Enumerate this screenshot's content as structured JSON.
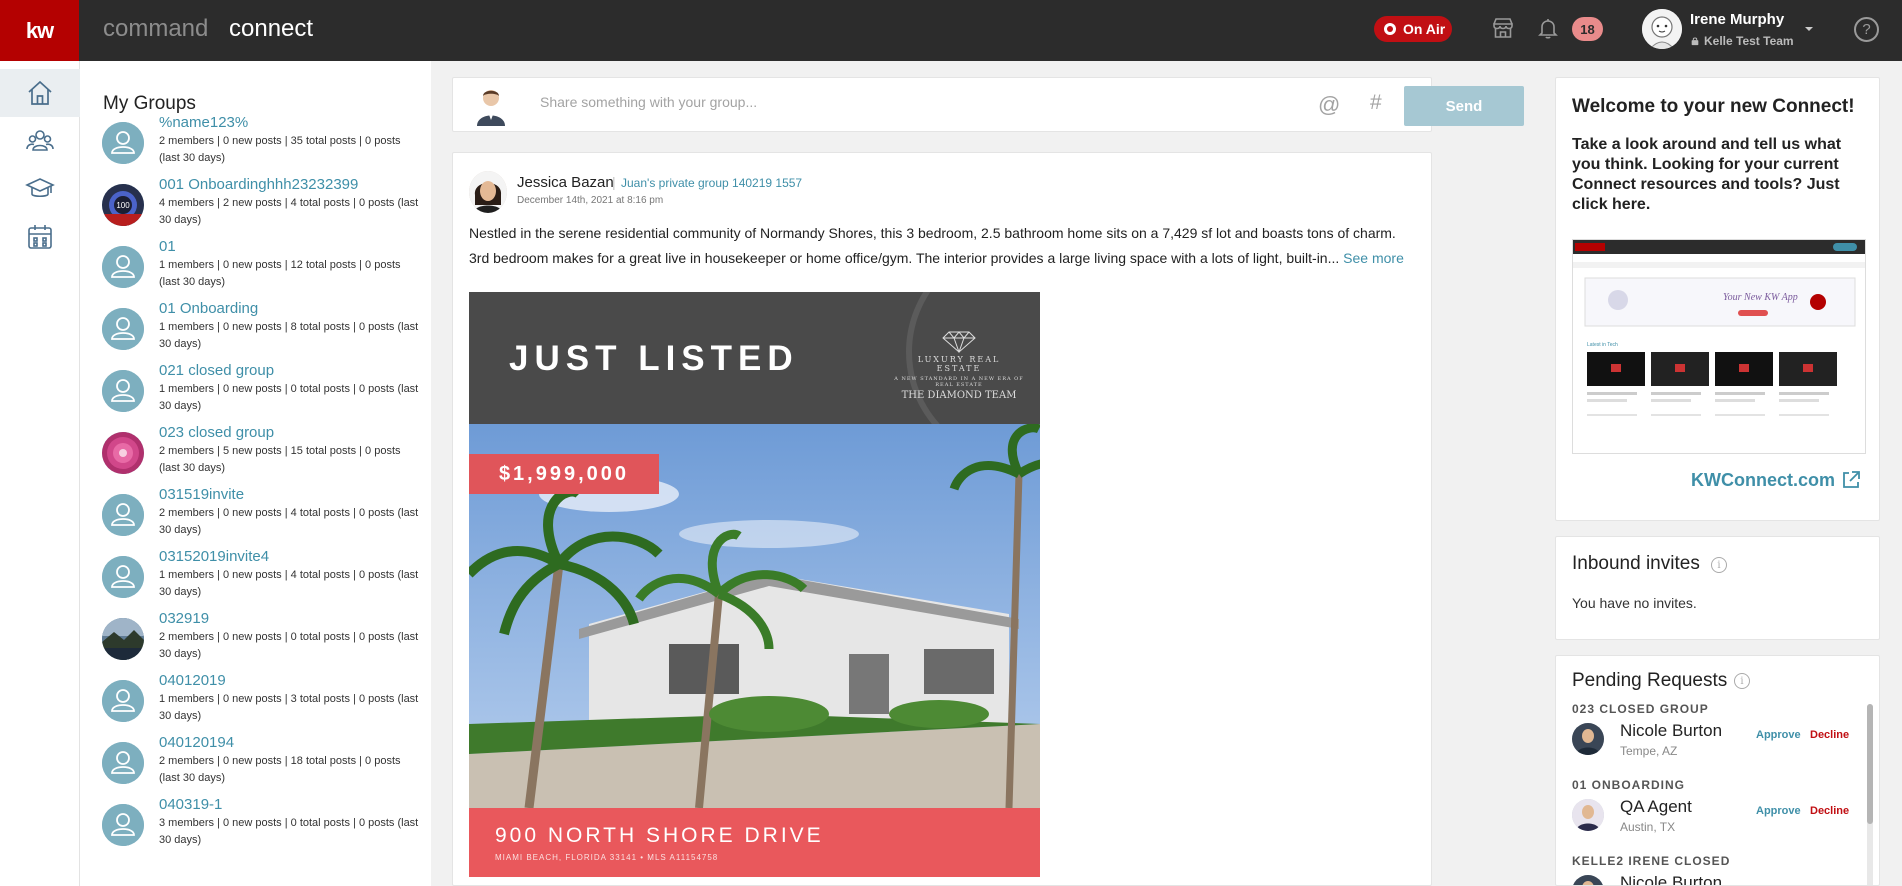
{
  "header": {
    "logo": "kw",
    "brand_command": "command",
    "brand_connect": "connect",
    "on_air_label": "On Air",
    "notification_count": "18",
    "user_name": "Irene Murphy",
    "user_team": "Kelle Test Team",
    "help_label": "?"
  },
  "rail": {
    "items": [
      {
        "icon": "home-icon",
        "active": true
      },
      {
        "icon": "groups-icon",
        "active": false
      },
      {
        "icon": "graduation-cap-icon",
        "active": false
      },
      {
        "icon": "calendar-icon",
        "active": false
      }
    ]
  },
  "groups": {
    "title": "My Groups",
    "items": [
      {
        "name": "%name123%",
        "meta": "2 members | 0 new posts | 35 total posts | 0 posts (last 30 days)",
        "avatar": "default"
      },
      {
        "name": "001 Onboardinghhh23232399",
        "meta": "4 members | 2 new posts | 4 total posts | 0 posts (last 30 days)",
        "avatar": "badge-100"
      },
      {
        "name": "01",
        "meta": "1 members | 0 new posts | 12 total posts | 0 posts (last 30 days)",
        "avatar": "default"
      },
      {
        "name": "01 Onboarding",
        "meta": "1 members | 0 new posts | 8 total posts | 0 posts (last 30 days)",
        "avatar": "default"
      },
      {
        "name": "021 closed group",
        "meta": "1 members | 0 new posts | 0 total posts | 0 posts (last 30 days)",
        "avatar": "default"
      },
      {
        "name": "023 closed group",
        "meta": "2 members | 5 new posts | 15 total posts | 0 posts (last 30 days)",
        "avatar": "flower"
      },
      {
        "name": "031519invite",
        "meta": "2 members | 0 new posts | 4 total posts | 0 posts (last 30 days)",
        "avatar": "default"
      },
      {
        "name": "03152019invite4",
        "meta": "1 members | 0 new posts | 4 total posts | 0 posts (last 30 days)",
        "avatar": "default"
      },
      {
        "name": "032919",
        "meta": "2 members | 0 new posts | 0 total posts | 0 posts (last 30 days)",
        "avatar": "landscape"
      },
      {
        "name": "04012019",
        "meta": "1 members | 0 new posts | 3 total posts | 0 posts (last 30 days)",
        "avatar": "default"
      },
      {
        "name": "040120194",
        "meta": "2 members | 0 new posts | 18 total posts | 0 posts (last 30 days)",
        "avatar": "default"
      },
      {
        "name": "040319-1",
        "meta": "3 members | 0 new posts | 0 total posts | 0 posts (last 30 days)",
        "avatar": "default"
      }
    ]
  },
  "composer": {
    "placeholder": "Share something with your group...",
    "at_symbol": "@",
    "hash_symbol": "#",
    "send_label": "Send"
  },
  "post": {
    "author": "Jessica Bazan",
    "separator": "|",
    "group": "Juan's private group 140219 1557",
    "date": "December 14th, 2021 at 8:16 pm",
    "text": "Nestled in the serene residential community of Normandy Shores, this 3 bedroom, 2.5 bathroom home sits on a 7,429 sf lot and boasts tons of charm. 3rd bedroom makes for a great live in housekeeper or home office/gym. The interior provides a large living space with a lots of light, built-in...",
    "see_more": "See more",
    "listing": {
      "headline": "JUST LISTED",
      "brand_line1": "LUXURY REAL ESTATE",
      "brand_line2": "A NEW STANDARD IN A NEW ERA OF REAL ESTATE",
      "brand_line3": "THE DIAMOND TEAM",
      "price": "$1,999,000",
      "address": "900 NORTH SHORE DRIVE",
      "address_sub": "MIAMI BEACH, FLORIDA 33141 • MLS A11154758"
    }
  },
  "welcome": {
    "title": "Welcome to your new Connect!",
    "body": "Take a look around and tell us what you think. Looking for your current Connect resources and tools? Just click here.",
    "link": "KWConnect.com"
  },
  "invites": {
    "title": "Inbound invites",
    "empty_text": "You have no invites."
  },
  "pending": {
    "title": "Pending Requests",
    "approve_label": "Approve",
    "decline_label": "Decline",
    "requests": [
      {
        "group": "023 CLOSED GROUP",
        "name": "Nicole Burton",
        "location": "Tempe, AZ"
      },
      {
        "group": "01 ONBOARDING",
        "name": "QA Agent",
        "location": "Austin, TX"
      },
      {
        "group": "KELLE2 IRENE CLOSED",
        "name": "Nicole Burton",
        "location": ""
      }
    ]
  },
  "colors": {
    "brand_red": "#b40101",
    "link_teal": "#3f8fa8",
    "topbar": "#2c2c2c",
    "listing_coral": "#e9585c"
  }
}
